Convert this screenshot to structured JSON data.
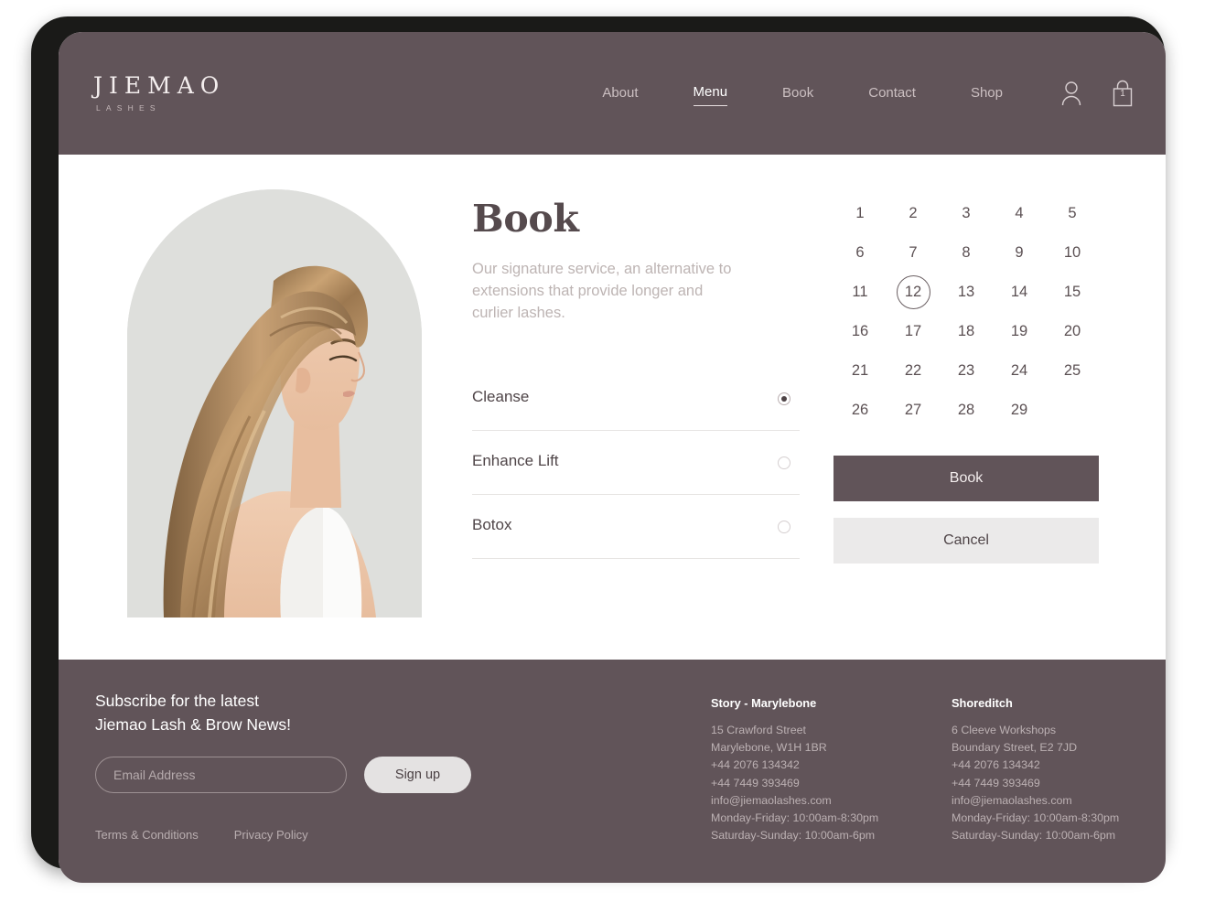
{
  "brand": {
    "name": "JIEMAO",
    "sub": "LASHES"
  },
  "nav": {
    "items": [
      {
        "label": "About",
        "active": false
      },
      {
        "label": "Menu",
        "active": true
      },
      {
        "label": "Book",
        "active": false
      },
      {
        "label": "Contact",
        "active": false
      },
      {
        "label": "Shop",
        "active": false
      }
    ],
    "account_icon": "user-icon",
    "bag_icon": "shopping-bag-icon",
    "bag_count": "1"
  },
  "booking": {
    "title": "Book",
    "description": "Our signature service, an alternative to extensions that provide longer and curlier lashes.",
    "options": [
      {
        "label": "Cleanse",
        "selected": true
      },
      {
        "label": "Enhance Lift",
        "selected": false
      },
      {
        "label": "Botox",
        "selected": false
      }
    ]
  },
  "calendar": {
    "days": [
      "1",
      "2",
      "3",
      "4",
      "5",
      "6",
      "7",
      "8",
      "9",
      "10",
      "11",
      "12",
      "13",
      "14",
      "15",
      "16",
      "17",
      "18",
      "19",
      "20",
      "21",
      "22",
      "23",
      "24",
      "25",
      "26",
      "27",
      "28",
      "29"
    ],
    "selected_day": "12",
    "columns": 5
  },
  "actions": {
    "book_label": "Book",
    "cancel_label": "Cancel"
  },
  "footer": {
    "subscribe_line1": "Subscribe for the latest",
    "subscribe_line2": "Jiemao Lash & Brow News!",
    "email_placeholder": "Email Address",
    "email_value": "",
    "signup_label": "Sign up",
    "terms_label": "Terms & Conditions",
    "privacy_label": "Privacy Policy",
    "stores": [
      {
        "name": "Story - Marylebone",
        "lines": [
          "15 Crawford Street",
          "Marylebone, W1H 1BR",
          "+44 2076 134342",
          "+44 7449 393469",
          "info@jiemaolashes.com",
          "Monday-Friday: 10:00am-8:30pm",
          "Saturday-Sunday: 10:00am-6pm"
        ]
      },
      {
        "name": "Shoreditch",
        "lines": [
          "6 Cleeve Workshops",
          "Boundary Street, E2 7JD",
          "+44 2076 134342",
          "+44 7449 393469",
          "info@jiemaolashes.com",
          "Monday-Friday: 10:00am-8:30pm",
          "Saturday-Sunday: 10:00am-6pm"
        ]
      }
    ]
  },
  "colors": {
    "brand_mauve": "#615459",
    "text_dark": "#4f4548",
    "text_muted": "#bdb4b3",
    "button_light": "#ebeaea",
    "bezel": "#1a1a18"
  }
}
